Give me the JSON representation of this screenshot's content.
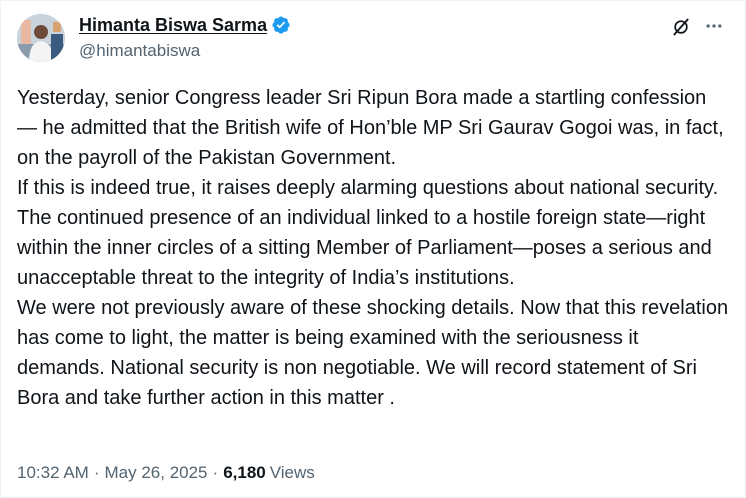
{
  "author": {
    "display_name": "Himanta Biswa Sarma",
    "handle": "@himantabiswa",
    "verified": true,
    "verified_color": "#1d9bf0",
    "avatar_icon": "profile-photo"
  },
  "post": {
    "text": "Yesterday, senior Congress leader Sri Ripun Bora made a startling confession — he admitted that the British wife of Hon’ble MP Sri Gaurav Gogoi was, in fact, on the payroll of the Pakistan Government.\nIf this is indeed true, it raises deeply alarming questions about national security. The continued presence of an individual linked to a hostile foreign state—right within the inner circles of a sitting Member of Parliament—poses a serious and unacceptable threat to the integrity of India’s institutions.\nWe were not previously aware of these shocking details. Now that this revelation has come to light, the matter is being examined with the seriousness it demands. National security is non negotiable. We will record statement of Sri Bora and take further action in this matter ."
  },
  "meta": {
    "time": "10:32 AM",
    "separator": "·",
    "date": "May 26, 2025",
    "views_count": "6,180",
    "views_label": "Views"
  },
  "icons": {
    "grok": "grok-icon",
    "more": "more-options-icon"
  }
}
